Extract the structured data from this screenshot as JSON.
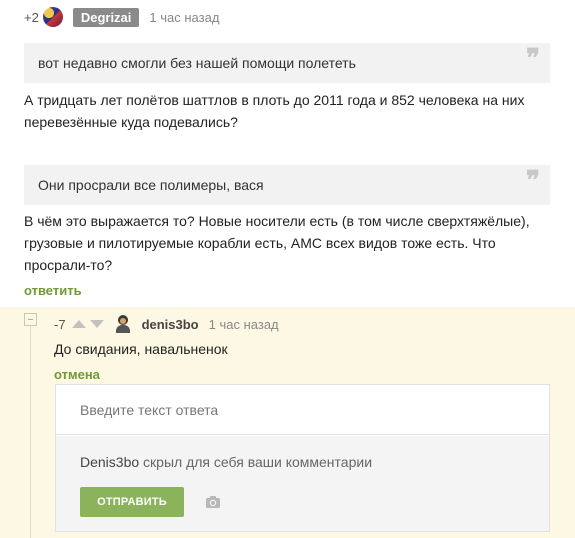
{
  "comment1": {
    "rating": "+2",
    "author": "Degrizai",
    "time": "1 час назад",
    "quote1": "вот недавно смогли без нашей помощи полететь",
    "para1": "А тридцать лет полётов шаттлов в плоть до 2011 года и 852 человека на них перевезённые куда подевались?",
    "quote2": "Они просрали все полимеры, вася",
    "para2": "В чём это выражается то? Новые носители есть (в том числе сверхтяжёлые), грузовые и пилотируемые корабли есть, АМС всех видов тоже есть. Что просрали-то?",
    "reply_label": "ответить",
    "quote_mark": "❞"
  },
  "comment2": {
    "rating": "-7",
    "author": "denis3bo",
    "time": "1 час назад",
    "text": "До свидания, навальненок",
    "cancel_label": "отмена"
  },
  "reply_form": {
    "placeholder": "Введите текст ответа",
    "hidden_user": "Denis3bo",
    "hidden_text": " скрыл для себя ваши комментарии",
    "submit_label": "ОТПРАВИТЬ"
  },
  "colors": {
    "accent_green": "#6f9a37",
    "button_green": "#8ab35b",
    "reply_bg": "#fdf8e4"
  }
}
